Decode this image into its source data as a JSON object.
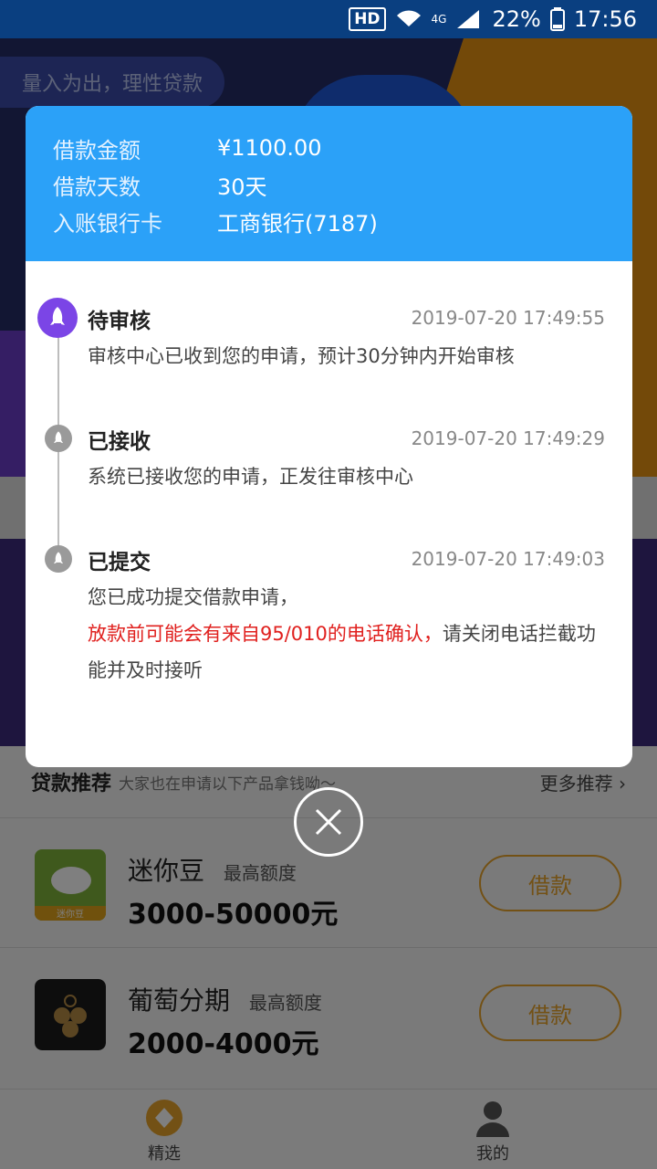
{
  "status_bar": {
    "hd": "HD",
    "network": "4G",
    "battery": "22%",
    "time": "17:56"
  },
  "background": {
    "slogan": "量入为出，理性贷款",
    "recommend": {
      "title": "贷款推荐",
      "subtitle": "大家也在申请以下产品拿钱呦～",
      "more": "更多推荐",
      "more_arrow": "›"
    },
    "products": [
      {
        "name": "迷你豆",
        "limit_label": "最高额度",
        "amount": "3000-50000元",
        "button": "借款",
        "logo_caption": "迷你豆"
      },
      {
        "name": "葡萄分期",
        "limit_label": "最高额度",
        "amount": "2000-4000元",
        "button": "借款"
      }
    ],
    "tabs": [
      {
        "label": "精选"
      },
      {
        "label": "我的"
      }
    ]
  },
  "dialog": {
    "info": [
      {
        "label": "借款金额",
        "value": "¥1100.00"
      },
      {
        "label": "借款天数",
        "value": "30天"
      },
      {
        "label": "入账银行卡",
        "value": "工商银行(7187)"
      }
    ],
    "timeline": [
      {
        "title": "待审核",
        "time": "2019-07-20 17:49:55",
        "desc": "审核中心已收到您的申请，预计30分钟内开始审核",
        "state": "active"
      },
      {
        "title": "已接收",
        "time": "2019-07-20 17:49:29",
        "desc": "系统已接收您的申请，正发往审核中心",
        "state": "done"
      },
      {
        "title": "已提交",
        "time": "2019-07-20 17:49:03",
        "desc": "您已成功提交借款申请，",
        "warning": "放款前可能会有来自95/010的电话确认，",
        "desc_tail": "请关闭电话拦截功能并及时接听",
        "state": "done"
      }
    ]
  },
  "colors": {
    "dialog_header": "#2ba1f8",
    "active_step": "#7b45e6",
    "warning": "#e0201e",
    "accent": "#e7a22b"
  }
}
